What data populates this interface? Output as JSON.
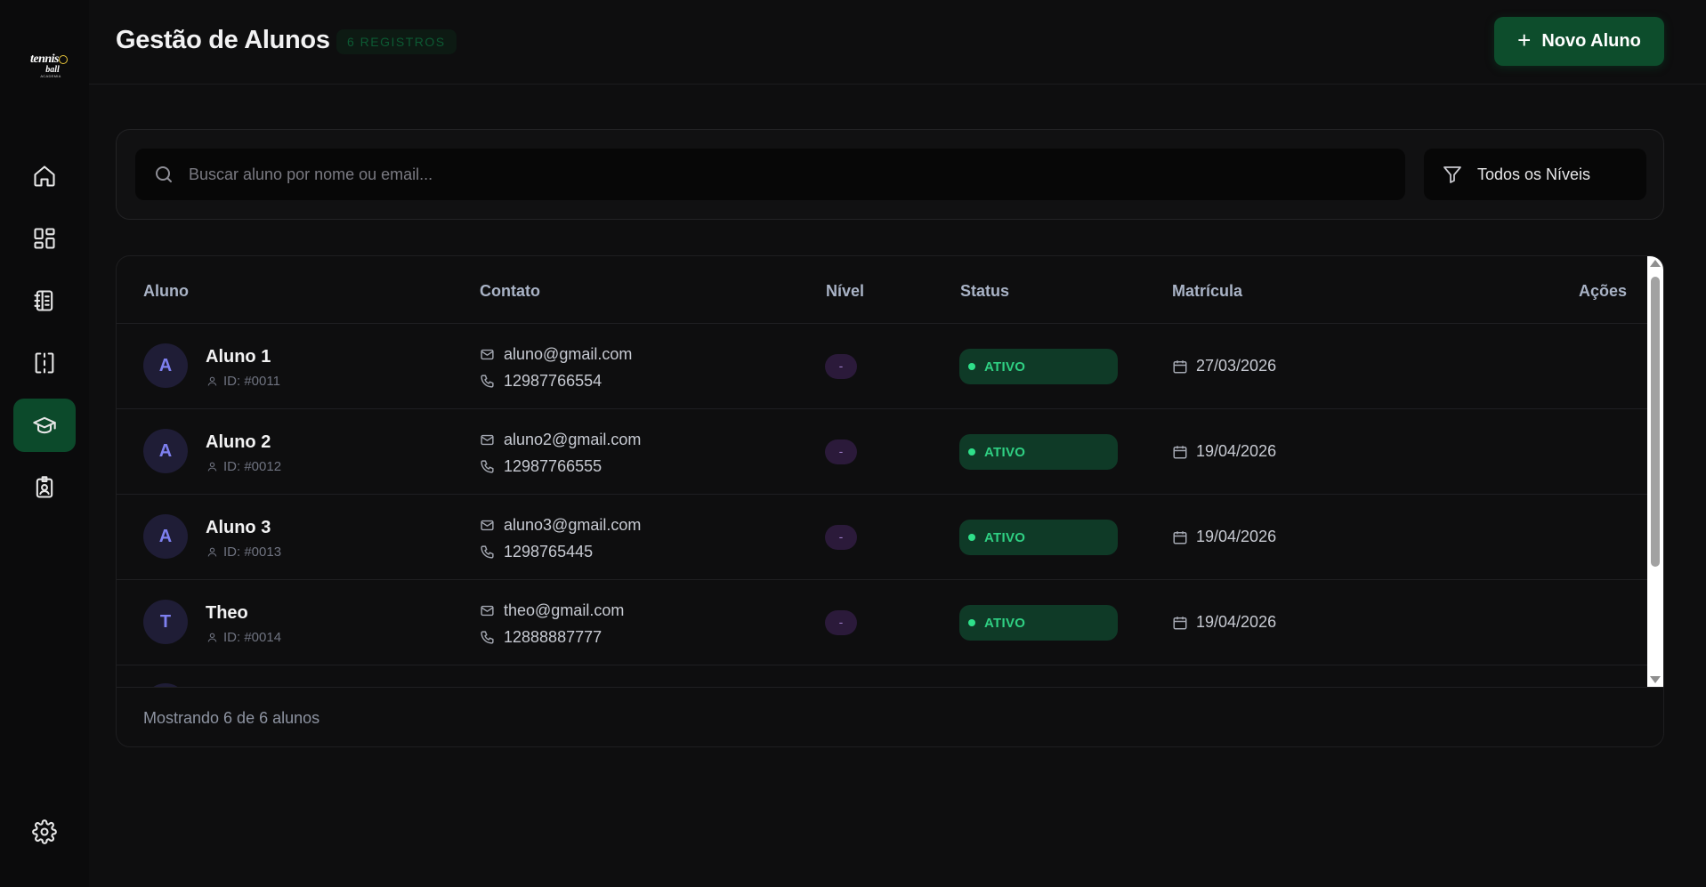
{
  "brand": {
    "logo_line1": "tennis",
    "logo_line2": "ball",
    "logo_line3": "ACADEMIA"
  },
  "sidebar": {
    "items": [
      {
        "name": "home",
        "icon": "home-icon"
      },
      {
        "name": "dashboard",
        "icon": "grid-icon"
      },
      {
        "name": "agenda",
        "icon": "notebook-icon"
      },
      {
        "name": "courts",
        "icon": "court-icon"
      },
      {
        "name": "students",
        "icon": "graduation-cap-icon",
        "active": true
      },
      {
        "name": "teachers",
        "icon": "id-badge-icon"
      }
    ],
    "settings_icon": "gear-icon"
  },
  "header": {
    "title": "Gestão de Alunos",
    "badge": "6 REGISTROS",
    "new_button": "Novo Aluno"
  },
  "search": {
    "placeholder": "Buscar aluno por nome ou email...",
    "filter_label": "Todos os Níveis"
  },
  "table": {
    "columns": [
      "Aluno",
      "Contato",
      "Nível",
      "Status",
      "Matrícula",
      "Ações"
    ],
    "rows": [
      {
        "initial": "A",
        "name": "Aluno 1",
        "id": "ID: #0011",
        "email": "aluno@gmail.com",
        "phone": "12987766554",
        "level": "-",
        "status": "ATIVO",
        "date": "27/03/2026"
      },
      {
        "initial": "A",
        "name": "Aluno 2",
        "id": "ID: #0012",
        "email": "aluno2@gmail.com",
        "phone": "12987766555",
        "level": "-",
        "status": "ATIVO",
        "date": "19/04/2026"
      },
      {
        "initial": "A",
        "name": "Aluno 3",
        "id": "ID: #0013",
        "email": "aluno3@gmail.com",
        "phone": "1298765445",
        "level": "-",
        "status": "ATIVO",
        "date": "19/04/2026"
      },
      {
        "initial": "T",
        "name": "Theo",
        "id": "ID: #0014",
        "email": "theo@gmail.com",
        "phone": "12888887777",
        "level": "-",
        "status": "ATIVO",
        "date": "19/04/2026"
      }
    ],
    "footer": "Mostrando 6 de 6 alunos"
  },
  "colors": {
    "accent": "#0d4d2c",
    "status_active": "#2fd083",
    "avatar_text": "#7e80f0"
  }
}
